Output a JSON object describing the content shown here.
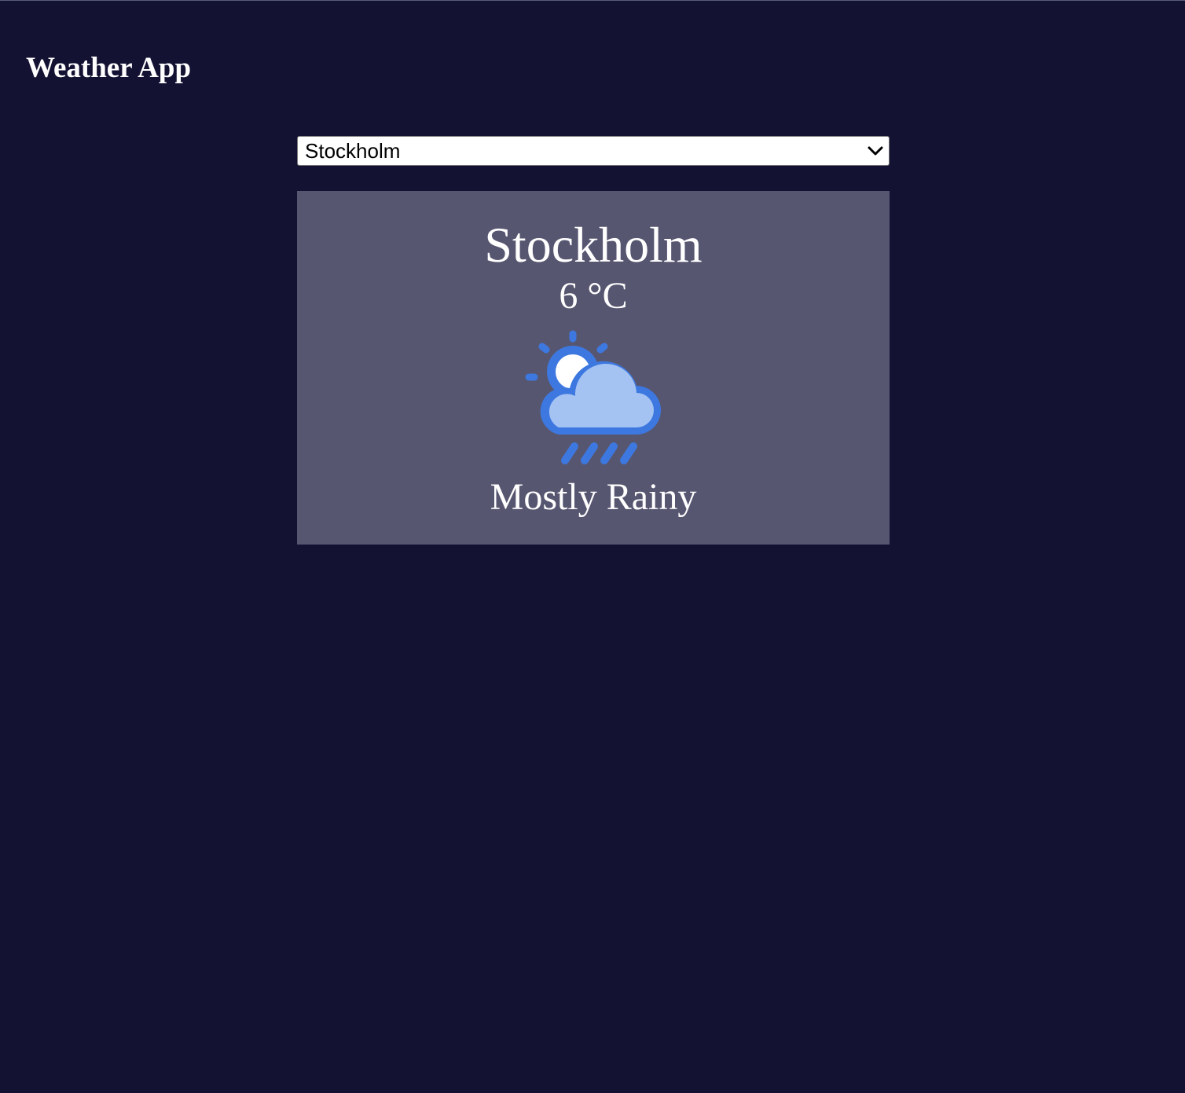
{
  "header": {
    "title": "Weather App"
  },
  "city_select": {
    "selected": "Stockholm"
  },
  "weather": {
    "city": "Stockholm",
    "temperature": "6 °C",
    "condition": "Mostly Rainy",
    "icon": "partly-cloudy-rain-icon"
  },
  "colors": {
    "background": "#141233",
    "card": "#575671",
    "icon_blue": "#3d78e0",
    "icon_light_blue": "#a4c3f2"
  }
}
